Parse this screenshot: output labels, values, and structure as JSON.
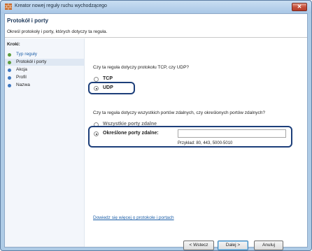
{
  "window": {
    "title": "Kreator nowej reguły ruchu wychodzącego",
    "close_label": "✕"
  },
  "header": {
    "title": "Protokół i porty",
    "subtitle": "Określ protokoły i porty, których dotyczy ta reguła."
  },
  "sidebar": {
    "steps_label": "Kroki:",
    "items": [
      {
        "label": "Typ reguły",
        "state": "done"
      },
      {
        "label": "Protokół i porty",
        "state": "current"
      },
      {
        "label": "Akcja",
        "state": "todo"
      },
      {
        "label": "Profil",
        "state": "todo"
      },
      {
        "label": "Nazwa",
        "state": "todo"
      }
    ]
  },
  "content": {
    "protocol_question": "Czy ta reguła dotyczy protokołu TCP, czy UDP?",
    "protocol_options": [
      {
        "label": "TCP",
        "selected": false
      },
      {
        "label": "UDP",
        "selected": true
      }
    ],
    "ports_question": "Czy ta reguła dotyczy wszystkich portów zdalnych, czy określonych portów zdalnych?",
    "ports_options": [
      {
        "label": "Wszystkie porty zdalne",
        "selected": false
      },
      {
        "label": "Określone porty zdalne:",
        "selected": true
      }
    ],
    "ports_input": {
      "value": "",
      "placeholder": ""
    },
    "example_text": "Przykład: 80, 443, 5000-5010",
    "learn_more_link": "Dowiedz się więcej o protokole i portach"
  },
  "buttons": {
    "back": "< Wstecz",
    "next": "Dalej >",
    "cancel": "Anuluj"
  },
  "colors": {
    "highlight_border": "#1d3f7a",
    "link": "#1d5fa8",
    "done_dot": "#5c9d3e",
    "todo_dot": "#3f78c0"
  }
}
